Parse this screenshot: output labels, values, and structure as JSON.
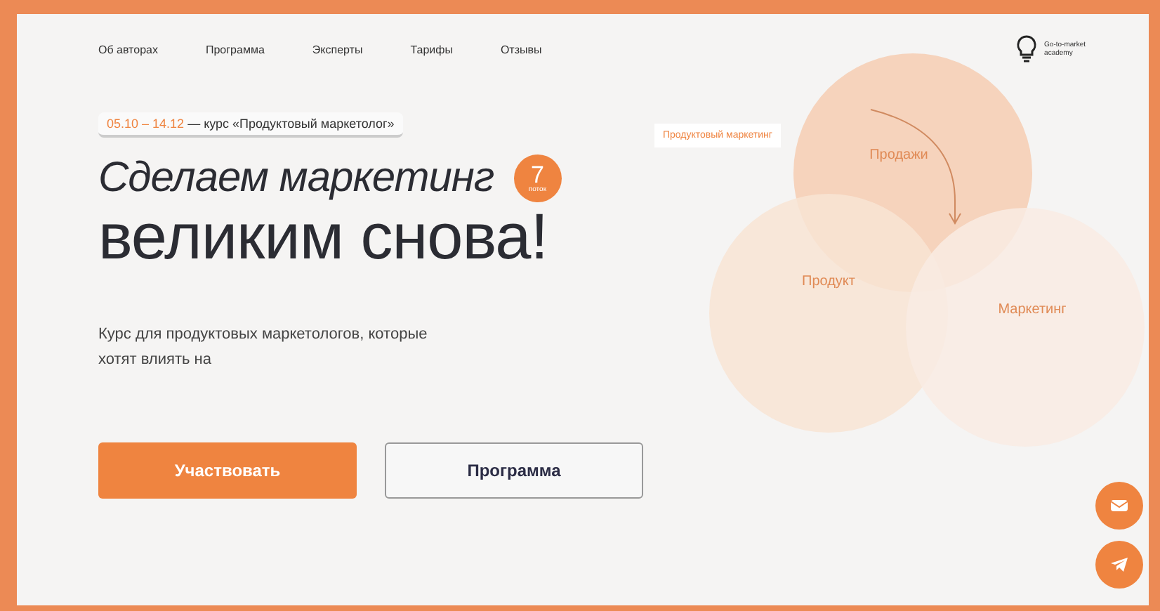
{
  "nav": [
    "Об авторах",
    "Программа",
    "Эксперты",
    "Тарифы",
    "Отзывы"
  ],
  "logo": {
    "line1": "Go-to-market",
    "line2": "academy"
  },
  "course_tag": {
    "dates": "05.10 – 14.12",
    "text": "— курс «Продуктовый маркетолог»"
  },
  "headline": {
    "line1": "Сделаем маркетинг",
    "line2": "великим снова!"
  },
  "badge": {
    "number": "7",
    "caption": "поток"
  },
  "subtitle": "Курс для продуктовых маркетологов, которые хотят влиять на",
  "buttons": [
    {
      "label": "Участвовать",
      "kind": "primary"
    },
    {
      "label": "Программа",
      "kind": "secondary"
    }
  ],
  "diagram": {
    "tag": "Продуктовый маркетинг",
    "circles": [
      "Продажи",
      "Продукт",
      "Маркетинг"
    ]
  },
  "floating": [
    {
      "kind": "mail"
    },
    {
      "kind": "telegram"
    }
  ]
}
